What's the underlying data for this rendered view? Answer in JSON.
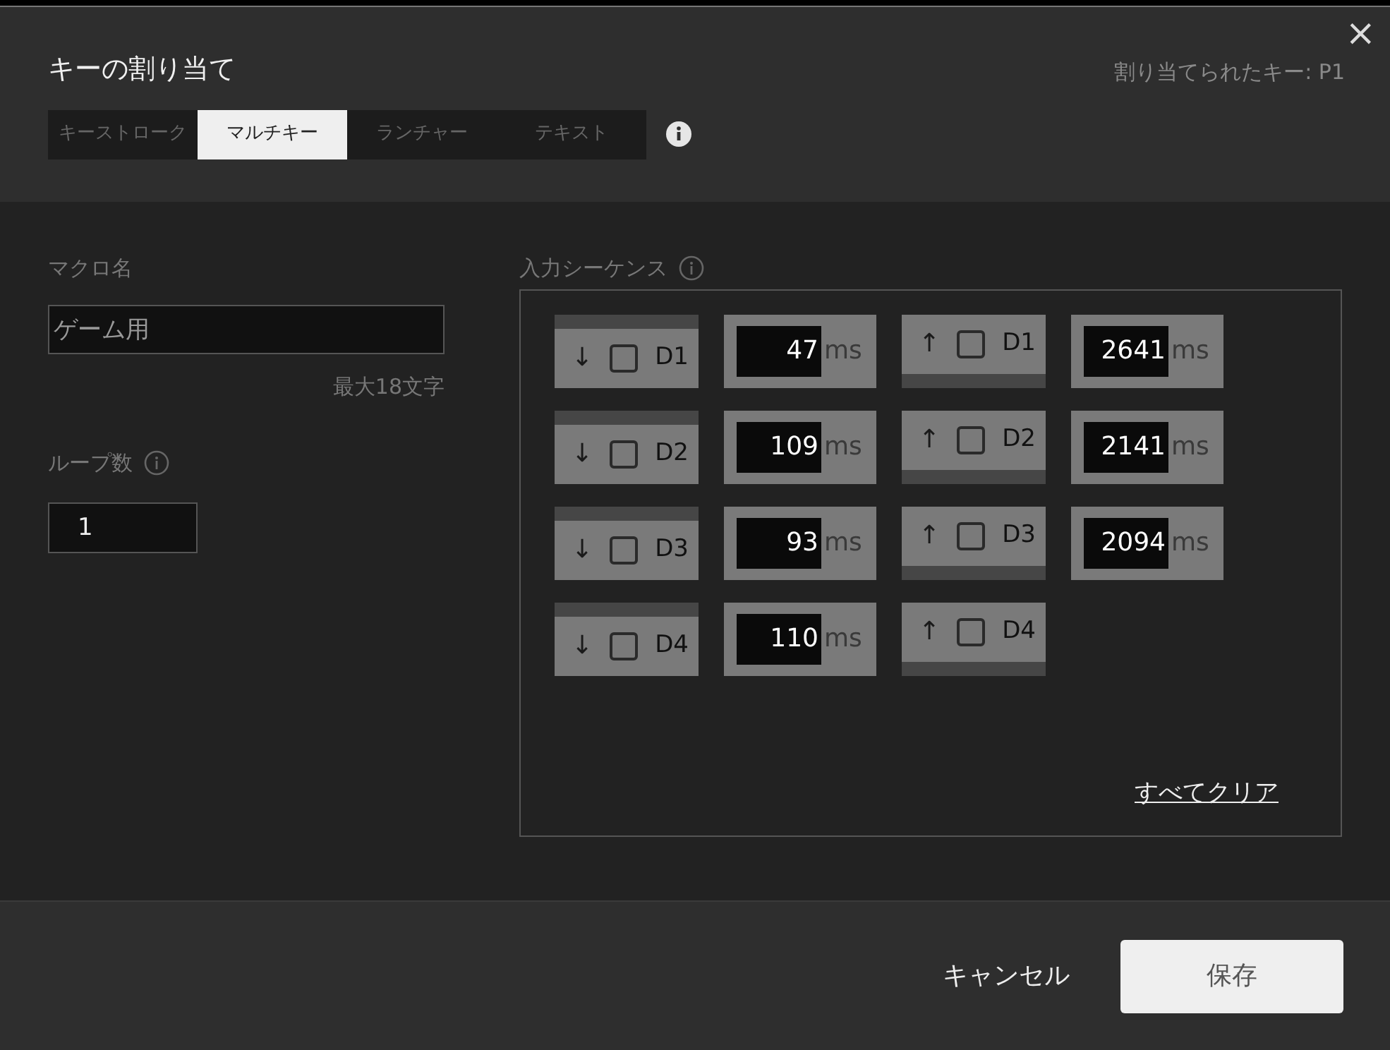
{
  "dialog": {
    "title": "キーの割り当て",
    "assigned_key": "割り当てられたキー: P1",
    "close": "×"
  },
  "tabs": [
    {
      "label": "キーストローク",
      "selected": false
    },
    {
      "label": "マルチキー",
      "selected": true
    },
    {
      "label": "ランチャー",
      "selected": false
    },
    {
      "label": "テキスト",
      "selected": false
    }
  ],
  "macro_name": {
    "label": "マクロ名",
    "value": "ゲーム用",
    "hint": "最大18文字"
  },
  "loop_count": {
    "label": "ループ数",
    "value": "1"
  },
  "sequence": {
    "label": "入力シーケンス",
    "clear_all": "すべてクリア",
    "items": [
      {
        "kind": "key",
        "key_down": true,
        "arrow": "↓",
        "checked": false,
        "key": "D1"
      },
      {
        "kind": "delay",
        "value": "47",
        "unit": "ms"
      },
      {
        "kind": "key",
        "key_down": false,
        "arrow": "↑",
        "checked": false,
        "key": "D1"
      },
      {
        "kind": "delay",
        "value": "2641",
        "unit": "ms"
      },
      {
        "kind": "key",
        "key_down": true,
        "arrow": "↓",
        "checked": false,
        "key": "D2"
      },
      {
        "kind": "delay",
        "value": "109",
        "unit": "ms"
      },
      {
        "kind": "key",
        "key_down": false,
        "arrow": "↑",
        "checked": false,
        "key": "D2"
      },
      {
        "kind": "delay",
        "value": "2141",
        "unit": "ms"
      },
      {
        "kind": "key",
        "key_down": true,
        "arrow": "↓",
        "checked": false,
        "key": "D3"
      },
      {
        "kind": "delay",
        "value": "93",
        "unit": "ms"
      },
      {
        "kind": "key",
        "key_down": false,
        "arrow": "↑",
        "checked": false,
        "key": "D3"
      },
      {
        "kind": "delay",
        "value": "2094",
        "unit": "ms"
      },
      {
        "kind": "key",
        "key_down": true,
        "arrow": "↓",
        "checked": false,
        "key": "D4"
      },
      {
        "kind": "delay",
        "value": "110",
        "unit": "ms"
      },
      {
        "kind": "key",
        "key_down": false,
        "arrow": "↑",
        "checked": false,
        "key": "D4"
      }
    ]
  },
  "buttons": [
    {
      "label": "キャンセル",
      "kind": "text"
    },
    {
      "label": "保存",
      "kind": "primary"
    }
  ]
}
